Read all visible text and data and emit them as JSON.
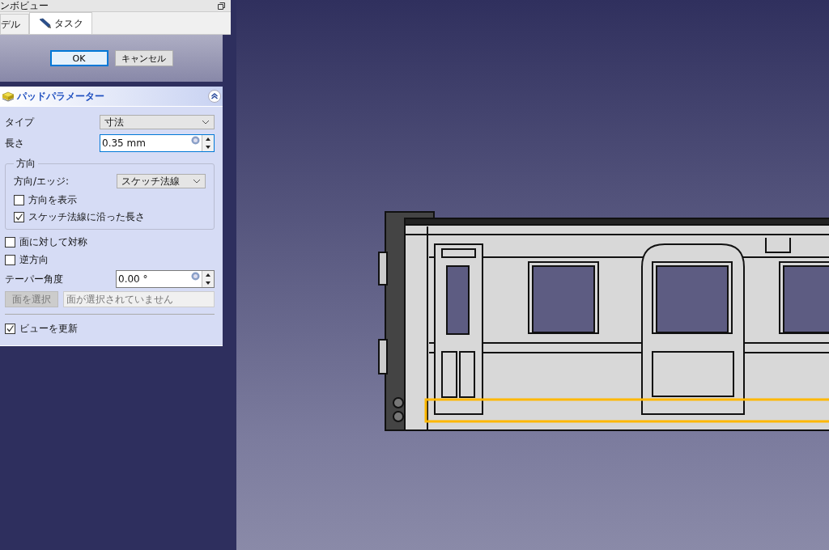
{
  "combo_view": {
    "title": "ンボビュー",
    "tabs": [
      {
        "label": "デル",
        "selected": false,
        "icon": false
      },
      {
        "label": "タスク",
        "selected": true,
        "icon": true
      }
    ]
  },
  "dialog_buttons": [
    {
      "label": "OK",
      "default": true
    },
    {
      "label": "キャンセル",
      "default": false
    }
  ],
  "pad_parameters": {
    "title": "パッドパラメーター",
    "type": {
      "label": "タイプ",
      "value": "寸法"
    },
    "length": {
      "label": "長さ",
      "value": "0.35 mm"
    },
    "direction": {
      "title": "方向",
      "edge_label": "方向/エッジ:",
      "edge_value": "スケッチ法線",
      "options": [
        {
          "label": "方向を表示",
          "checked": false
        },
        {
          "label": "スケッチ法線に沿った長さ",
          "checked": true
        }
      ]
    },
    "options": [
      {
        "label": "面に対して対称",
        "checked": false
      },
      {
        "label": "逆方向",
        "checked": false
      }
    ],
    "taper": {
      "label": "テーパー角度",
      "value": "0.00 °"
    },
    "face_button": {
      "label": "面を選択",
      "disabled": true
    },
    "face_field": {
      "placeholder": "面が選択されていません"
    },
    "update_view": {
      "label": "ビューを更新",
      "checked": true
    }
  }
}
